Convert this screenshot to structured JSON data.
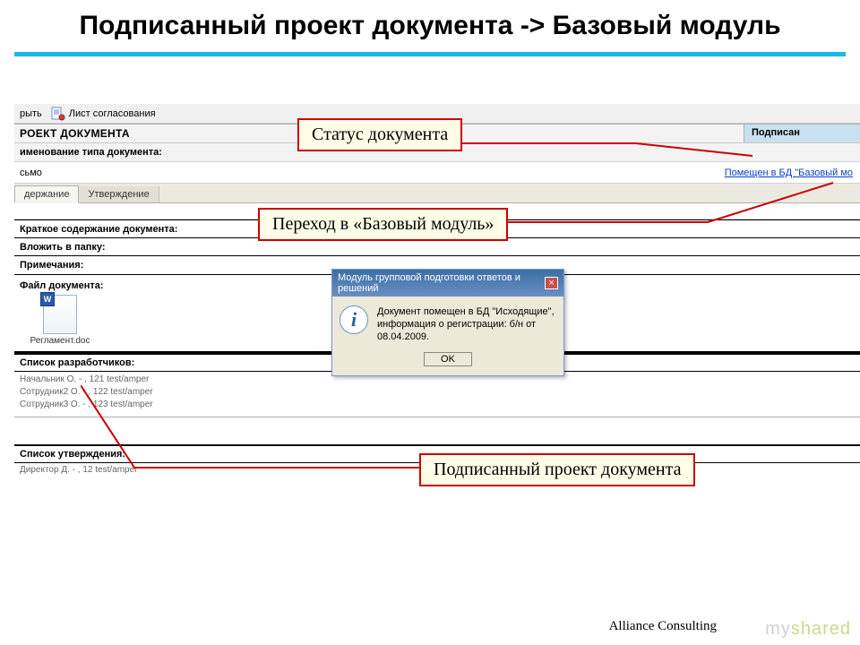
{
  "slide": {
    "title": "Подписанный проект документа -> Базовый модуль"
  },
  "toolbar": {
    "open": "рыть",
    "approval_sheet": "Лист согласования"
  },
  "doc_header": {
    "caption": "РОЕКТ ДОКУМЕНТА",
    "status": "Подписан"
  },
  "type_label": "именование типа документа:",
  "type_value": "сьмо",
  "db_link": "Помещен в БД \"Базовый мо",
  "tabs": {
    "content": "держание",
    "approval": "Утверждение"
  },
  "fields": {
    "summary_label": "Краткое содержание документа:",
    "folder_label": "Вложить в папку:",
    "notes_label": "Примечания:"
  },
  "file_section_label": "Файл документа:",
  "file_name": "Регламент.doc",
  "dev_header": "Список разработчиков:",
  "developers": [
    "Начальник О. - , 121 test/amper",
    "Сотрудник2 О. - , 122 test/amper",
    "Сотрудник3 О. - , 123 test/amper"
  ],
  "appr_header": "Список утверждения:",
  "approvers": [
    "Директор Д. - , 12 test/amper"
  ],
  "dialog": {
    "title": "Модуль групповой подготовки ответов и решений",
    "message": "Документ помещен в БД \"Исходящие\", информация о регистрации:  б/н  от 08.04.2009.",
    "ok": "OK"
  },
  "callouts": {
    "status": "Статус документа",
    "goto_base": "Переход в «Базовый модуль»",
    "signed": "Подписанный  проект документа"
  },
  "footer": "Alliance Consulting",
  "watermark": {
    "my": "my",
    "shared": "shared"
  }
}
